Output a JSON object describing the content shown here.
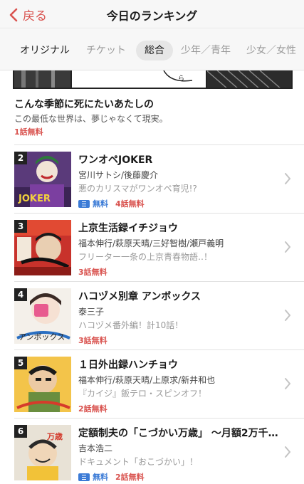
{
  "nav": {
    "back_label": "戻る",
    "title": "今日のランキング"
  },
  "tabs": [
    {
      "label": "オリジナル",
      "active": false
    },
    {
      "label": "チケット",
      "active": false
    },
    {
      "label": "総合",
      "active": true
    },
    {
      "label": "少年／青年",
      "active": false
    },
    {
      "label": "少女／女性",
      "active": false
    }
  ],
  "feature": {
    "title": "こんな季節に死にたいあたしの",
    "subtitle": "この最低な世界は、夢じゃなくて現実。",
    "free": "1話無料"
  },
  "rankings": [
    {
      "rank": "2",
      "title": "ワンオペJOKER",
      "author": "宮川サトシ/後藤慶介",
      "desc": "悪のカリスマがワンオペ育児!?",
      "ticket": true,
      "ticket_label": "無料",
      "free": "4話無料"
    },
    {
      "rank": "3",
      "title": "上京生活録イチジョウ",
      "author": "福本伸行/萩原天晴/三好智樹/瀬戸義明",
      "desc": "フリーター一条の上京青春物語‥！",
      "ticket": false,
      "ticket_label": "",
      "free": "3話無料"
    },
    {
      "rank": "4",
      "title": "ハコヅメ別章 アンボックス",
      "author": "泰三子",
      "desc": "ハコヅメ番外編！計10話！",
      "ticket": false,
      "ticket_label": "",
      "free": "3話無料"
    },
    {
      "rank": "5",
      "title": "１日外出録ハンチョウ",
      "author": "福本伸行/萩原天晴/上原求/新井和也",
      "desc": "『カイジ』飯テロ・スピンオフ！",
      "ticket": false,
      "ticket_label": "",
      "free": "2話無料"
    },
    {
      "rank": "6",
      "title": "定額制夫の「こづかい万歳」 〜月額2万千円…",
      "author": "吉本浩二",
      "desc": "ドキュメント「おこづかい」！",
      "ticket": true,
      "ticket_label": "無料",
      "free": "2話無料"
    }
  ],
  "colors": {
    "accent": "#d9534f",
    "ticket": "#3b7bd6"
  }
}
